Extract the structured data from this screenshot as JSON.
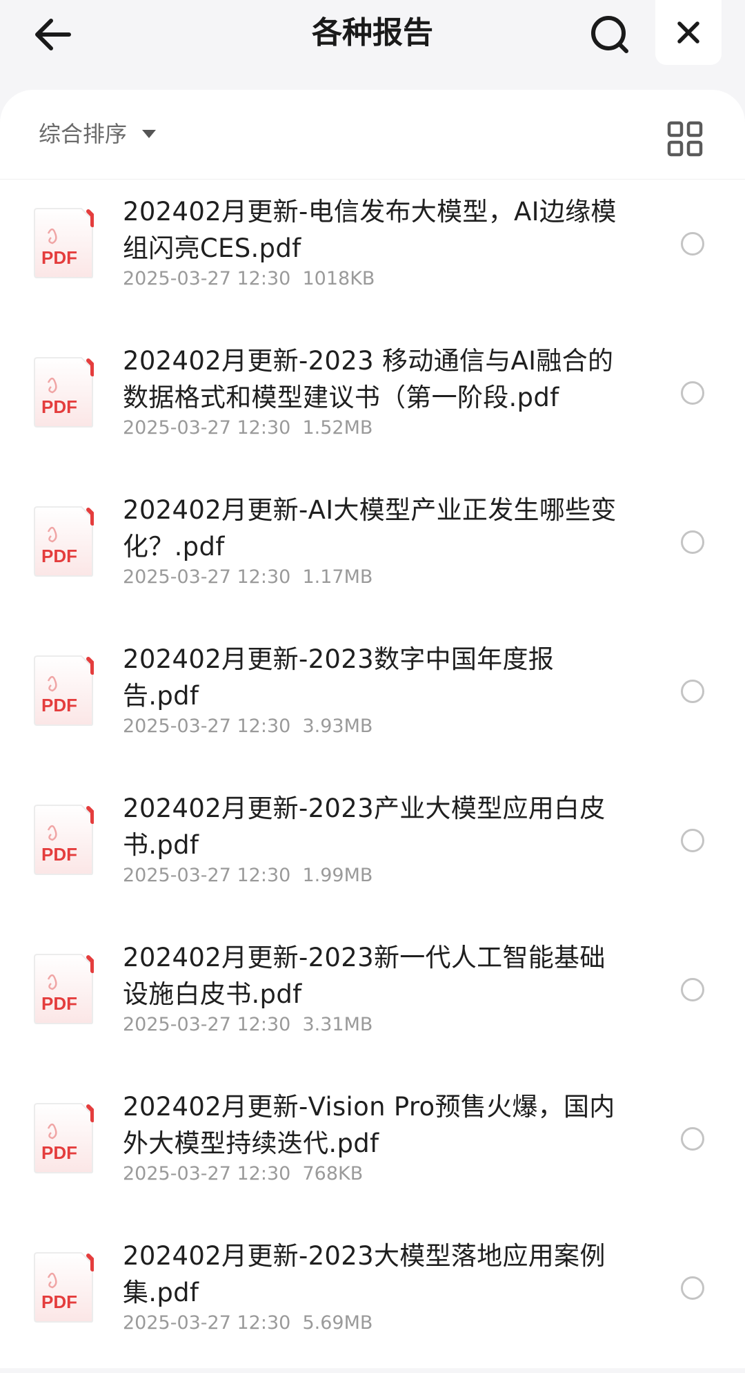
{
  "header": {
    "title": "各种报告",
    "back_icon": "arrow-left-icon",
    "search_icon": "search-icon",
    "close_icon": "close-icon"
  },
  "toolbar": {
    "sort_label": "综合排序",
    "sort_icon": "caret-down-icon",
    "view_icon": "grid-view-icon"
  },
  "colors": {
    "pdf_red": "#e43d3d",
    "background": "#f5f5f7",
    "text": "#1f1f1f",
    "meta": "#9a9a9a"
  },
  "files": [
    {
      "name": "202402月更新-电信发布大模型，AI边缘模组闪亮CES.pdf",
      "date": "2025-03-27 12:30",
      "size": "1018KB",
      "icon_label": "PDF"
    },
    {
      "name": "202402月更新-2023 移动通信与AI融合的数据格式和模型建议书（第一阶段.pdf",
      "date": "2025-03-27 12:30",
      "size": "1.52MB",
      "icon_label": "PDF"
    },
    {
      "name": "202402月更新-AI大模型产业正发生哪些变化？.pdf",
      "date": "2025-03-27 12:30",
      "size": "1.17MB",
      "icon_label": "PDF"
    },
    {
      "name": "202402月更新-2023数字中国年度报告.pdf",
      "date": "2025-03-27 12:30",
      "size": "3.93MB",
      "icon_label": "PDF"
    },
    {
      "name": "202402月更新-2023产业大模型应用白皮书.pdf",
      "date": "2025-03-27 12:30",
      "size": "1.99MB",
      "icon_label": "PDF"
    },
    {
      "name": "202402月更新-2023新一代人工智能基础设施白皮书.pdf",
      "date": "2025-03-27 12:30",
      "size": "3.31MB",
      "icon_label": "PDF"
    },
    {
      "name": "202402月更新-Vision Pro预售火爆，国内外大模型持续迭代.pdf",
      "date": "2025-03-27 12:30",
      "size": "768KB",
      "icon_label": "PDF"
    },
    {
      "name": "202402月更新-2023大模型落地应用案例集.pdf",
      "date": "2025-03-27 12:30",
      "size": "5.69MB",
      "icon_label": "PDF"
    }
  ]
}
